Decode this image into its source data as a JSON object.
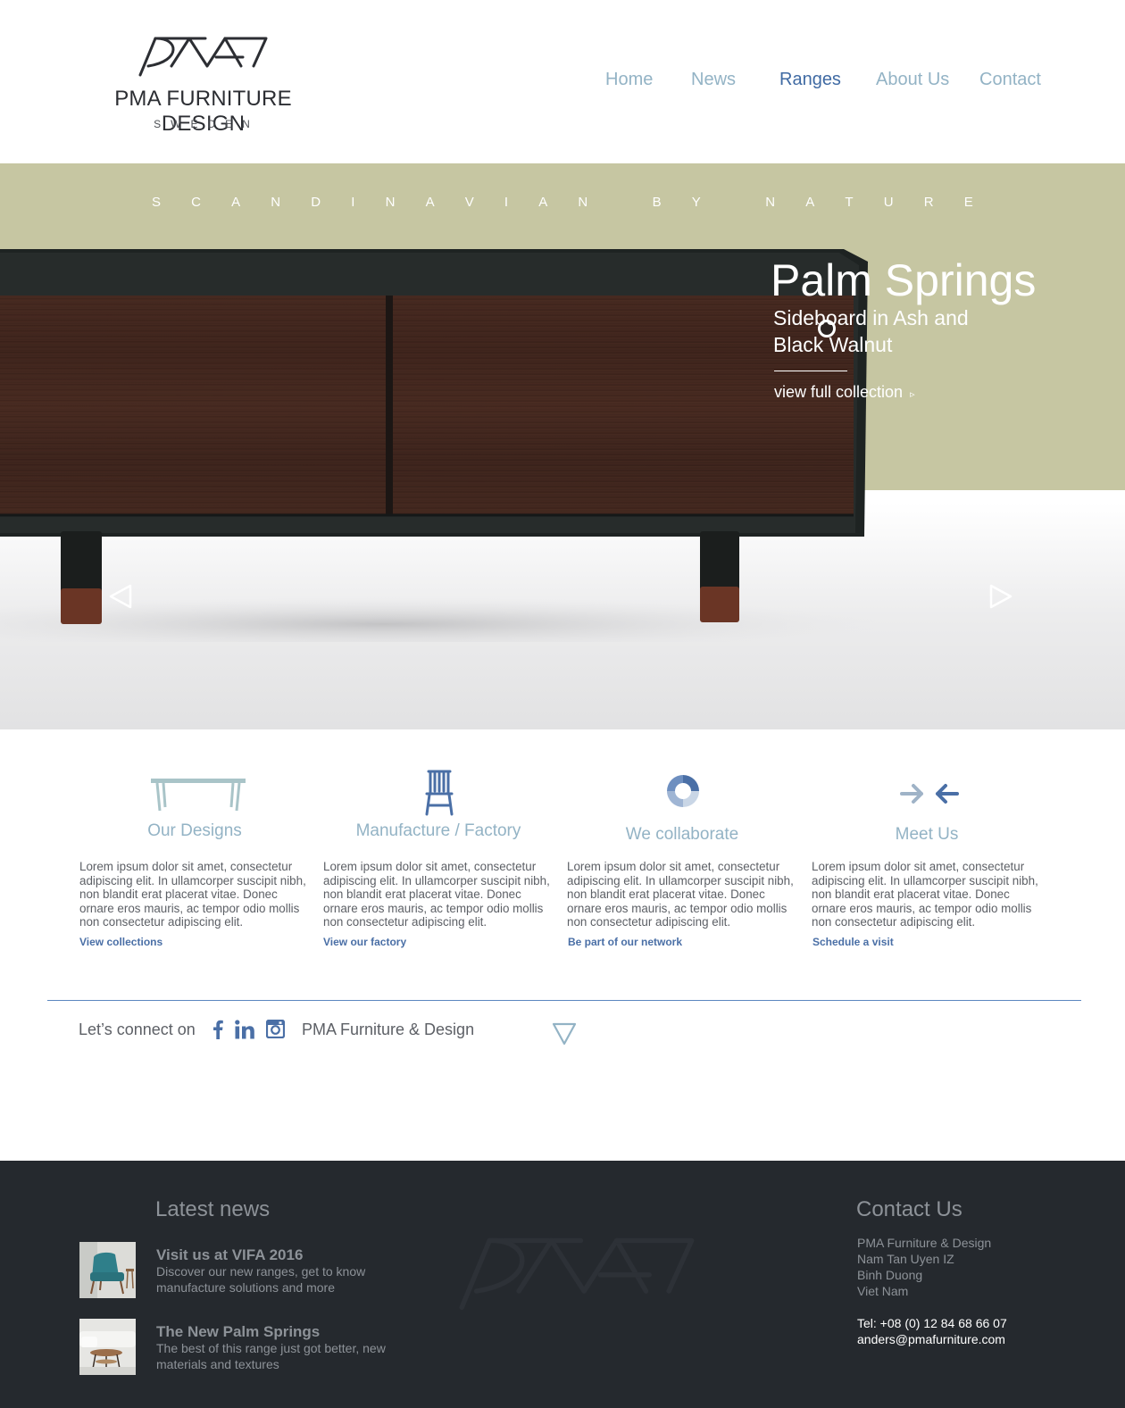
{
  "header": {
    "logo_name": "PMA FURNITURE DESIGN",
    "logo_sub": "SWEDEN",
    "nav": [
      {
        "label": "Home"
      },
      {
        "label": "News"
      },
      {
        "label": "Ranges",
        "active": true
      },
      {
        "label": "About Us"
      },
      {
        "label": "Contact"
      }
    ]
  },
  "hero": {
    "tagline_letters": [
      "S",
      "C",
      "A",
      "N",
      "D",
      "I",
      "N",
      "A",
      "V",
      "I",
      "A",
      "N",
      "",
      "B",
      "Y",
      "",
      "N",
      "A",
      "T",
      "U",
      "R",
      "E"
    ],
    "title": "Palm Springs",
    "subtitle_line1": "Sideboard in Ash and",
    "subtitle_line2": "Black Walnut",
    "link": "view full collection",
    "link_icon": "▹",
    "band_color": "#c6c6a2"
  },
  "features": [
    {
      "title": "Our Designs",
      "icon": "table-icon",
      "body": "Lorem ipsum dolor sit amet, consectetur adipiscing elit. In ullamcorper suscipit nibh, non blandit erat placerat vitae. Donec ornare eros mauris, ac tempor odio mollis non consectetur adipiscing elit.",
      "link": "View collections"
    },
    {
      "title": "Manufacture / Factory",
      "icon": "chair-icon",
      "body": "Lorem ipsum dolor sit amet, consectetur adipiscing elit. In ullamcorper suscipit nibh, non blandit erat placerat vitae. Donec ornare eros mauris, ac tempor odio mollis non consectetur adipiscing elit.",
      "link": "View our factory"
    },
    {
      "title": "We collaborate",
      "icon": "ring-icon",
      "body": "Lorem ipsum dolor sit amet, consectetur adipiscing elit. In ullamcorper suscipit nibh, non blandit erat placerat vitae. Donec ornare eros mauris, ac tempor odio mollis non consectetur adipiscing elit.",
      "link": "Be part of our network"
    },
    {
      "title": "Meet Us",
      "icon": "converging-arrows-icon",
      "body": "Lorem ipsum dolor sit amet, consectetur adipiscing elit. In ullamcorper suscipit nibh, non blandit erat placerat vitae. Donec ornare eros mauris, ac tempor odio mollis non consectetur adipiscing elit.",
      "link": "Schedule a visit"
    }
  ],
  "connect": {
    "label": "Let’s connect on",
    "brand": "PMA Furniture & Design",
    "networks": [
      "facebook-icon",
      "linkedin-icon",
      "instagram-icon"
    ]
  },
  "footer": {
    "news_heading": "Latest news",
    "news": [
      {
        "title": "Visit us at VIFA 2016",
        "text": "Discover our new ranges, get to know manufacture solutions and more"
      },
      {
        "title": "The New Palm Springs",
        "text": "The best of this range just got better, new materials and textures"
      }
    ],
    "contact_heading": "Contact Us",
    "address": [
      "PMA Furniture & Design",
      "Nam Tan Uyen IZ",
      "Binh Duong",
      "Viet Nam"
    ],
    "phone": "Tel: +08 (0) 12 84 68 66 07",
    "email": "anders@pmafurniture.com"
  },
  "colors": {
    "accent": "#3f6aa3",
    "nav": "#93b3c5",
    "footer_bg": "#25292e"
  }
}
